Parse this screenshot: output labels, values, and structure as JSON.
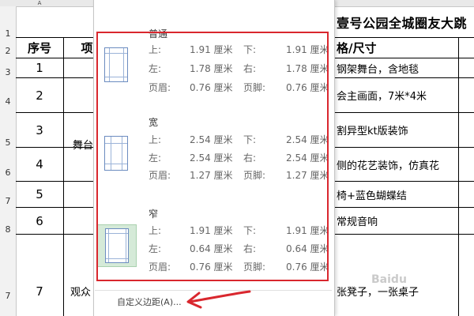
{
  "sheet": {
    "col_headers": [
      "A"
    ],
    "row_headers": [
      "1",
      "2",
      "3",
      "4",
      "5",
      "6",
      "7",
      "8",
      "7"
    ],
    "title_partial": "壹号公园全城圈友大跳",
    "header_row": {
      "seq": "序号",
      "item_partial": "项",
      "spec_partial": "格/尺寸"
    },
    "seq_numbers": [
      "1",
      "2",
      "3",
      "4",
      "5",
      "6",
      "7"
    ],
    "group_label_partial": "舞台",
    "audience_label_partial": "观众",
    "descriptions": [
      "钢架舞台，含地毯",
      "会主画面，7米*4米",
      "割异型kt版装饰",
      "侧的花艺装饰，仿真花",
      "椅+蓝色蝴蝶结",
      "常规音响",
      "张凳子，一张桌子"
    ]
  },
  "margin_menu": {
    "presets": [
      {
        "name": "普通",
        "top_label": "上:",
        "top_value": "1.91 厘米",
        "bottom_label": "下:",
        "bottom_value": "1.91 厘米",
        "left_label": "左:",
        "left_value": "1.78 厘米",
        "right_label": "右:",
        "right_value": "1.78 厘米",
        "header_label": "页眉:",
        "header_value": "0.76 厘米",
        "footer_label": "页脚:",
        "footer_value": "0.76 厘米"
      },
      {
        "name": "宽",
        "top_label": "上:",
        "top_value": "2.54 厘米",
        "bottom_label": "下:",
        "bottom_value": "2.54 厘米",
        "left_label": "左:",
        "left_value": "2.54 厘米",
        "right_label": "右:",
        "right_value": "2.54 厘米",
        "header_label": "页眉:",
        "header_value": "1.27 厘米",
        "footer_label": "页脚:",
        "footer_value": "1.27 厘米"
      },
      {
        "name": "窄",
        "top_label": "上:",
        "top_value": "1.91 厘米",
        "bottom_label": "下:",
        "bottom_value": "1.91 厘米",
        "left_label": "左:",
        "left_value": "0.64 厘米",
        "right_label": "右:",
        "right_value": "0.64 厘米",
        "header_label": "页眉:",
        "header_value": "0.76 厘米",
        "footer_label": "页脚:",
        "footer_value": "0.76 厘米"
      }
    ],
    "custom_margins_label": "自定义边距",
    "custom_margins_hotkey": "(A)...",
    "selected_preset": "窄"
  },
  "colors": {
    "annotation_red": "#d9272e",
    "selected_bg": "#d5ead8",
    "thumb_border": "#6c8cc0"
  },
  "watermark": "Baidu"
}
